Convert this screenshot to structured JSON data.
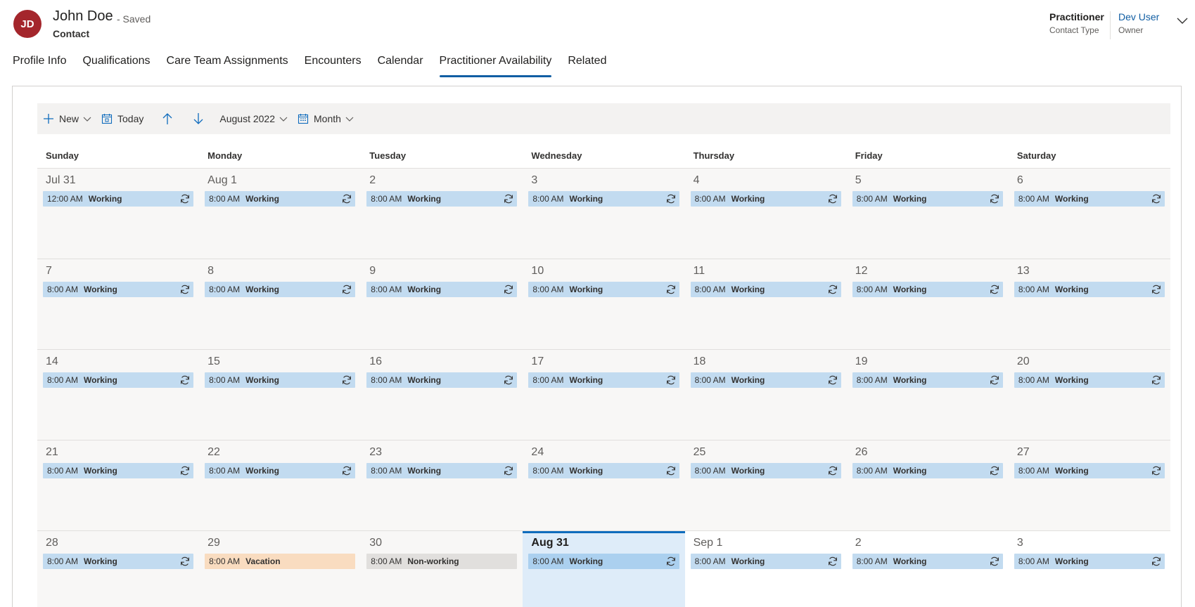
{
  "record": {
    "avatar_initials": "JD",
    "name": "John Doe",
    "saved_status": "- Saved",
    "entity": "Contact",
    "avatar_color": "#a4262c"
  },
  "header_fields": {
    "contact_type_value": "Practitioner",
    "contact_type_label": "Contact Type",
    "owner_value": "Dev User",
    "owner_label": "Owner"
  },
  "tabs": [
    {
      "label": "Profile Info"
    },
    {
      "label": "Qualifications"
    },
    {
      "label": "Care Team Assignments"
    },
    {
      "label": "Encounters"
    },
    {
      "label": "Calendar"
    },
    {
      "label": "Practitioner Availability",
      "active": true
    },
    {
      "label": "Related"
    }
  ],
  "toolbar": {
    "new_label": "New",
    "today_label": "Today",
    "date_label": "August 2022",
    "view_label": "Month"
  },
  "days_of_week": [
    "Sunday",
    "Monday",
    "Tuesday",
    "Wednesday",
    "Thursday",
    "Friday",
    "Saturday"
  ],
  "weeks": [
    [
      {
        "day": "Jul 31",
        "time": "12:00 AM",
        "title": "Working",
        "kind": "working"
      },
      {
        "day": "Aug 1",
        "time": "8:00 AM",
        "title": "Working",
        "kind": "working"
      },
      {
        "day": "2",
        "time": "8:00 AM",
        "title": "Working",
        "kind": "working"
      },
      {
        "day": "3",
        "time": "8:00 AM",
        "title": "Working",
        "kind": "working"
      },
      {
        "day": "4",
        "time": "8:00 AM",
        "title": "Working",
        "kind": "working"
      },
      {
        "day": "5",
        "time": "8:00 AM",
        "title": "Working",
        "kind": "working"
      },
      {
        "day": "6",
        "time": "8:00 AM",
        "title": "Working",
        "kind": "working"
      }
    ],
    [
      {
        "day": "7",
        "time": "8:00 AM",
        "title": "Working",
        "kind": "working"
      },
      {
        "day": "8",
        "time": "8:00 AM",
        "title": "Working",
        "kind": "working"
      },
      {
        "day": "9",
        "time": "8:00 AM",
        "title": "Working",
        "kind": "working"
      },
      {
        "day": "10",
        "time": "8:00 AM",
        "title": "Working",
        "kind": "working"
      },
      {
        "day": "11",
        "time": "8:00 AM",
        "title": "Working",
        "kind": "working"
      },
      {
        "day": "12",
        "time": "8:00 AM",
        "title": "Working",
        "kind": "working"
      },
      {
        "day": "13",
        "time": "8:00 AM",
        "title": "Working",
        "kind": "working"
      }
    ],
    [
      {
        "day": "14",
        "time": "8:00 AM",
        "title": "Working",
        "kind": "working"
      },
      {
        "day": "15",
        "time": "8:00 AM",
        "title": "Working",
        "kind": "working"
      },
      {
        "day": "16",
        "time": "8:00 AM",
        "title": "Working",
        "kind": "working"
      },
      {
        "day": "17",
        "time": "8:00 AM",
        "title": "Working",
        "kind": "working"
      },
      {
        "day": "18",
        "time": "8:00 AM",
        "title": "Working",
        "kind": "working"
      },
      {
        "day": "19",
        "time": "8:00 AM",
        "title": "Working",
        "kind": "working"
      },
      {
        "day": "20",
        "time": "8:00 AM",
        "title": "Working",
        "kind": "working"
      }
    ],
    [
      {
        "day": "21",
        "time": "8:00 AM",
        "title": "Working",
        "kind": "working"
      },
      {
        "day": "22",
        "time": "8:00 AM",
        "title": "Working",
        "kind": "working"
      },
      {
        "day": "23",
        "time": "8:00 AM",
        "title": "Working",
        "kind": "working"
      },
      {
        "day": "24",
        "time": "8:00 AM",
        "title": "Working",
        "kind": "working"
      },
      {
        "day": "25",
        "time": "8:00 AM",
        "title": "Working",
        "kind": "working"
      },
      {
        "day": "26",
        "time": "8:00 AM",
        "title": "Working",
        "kind": "working"
      },
      {
        "day": "27",
        "time": "8:00 AM",
        "title": "Working",
        "kind": "working"
      }
    ],
    [
      {
        "day": "28",
        "time": "8:00 AM",
        "title": "Working",
        "kind": "working"
      },
      {
        "day": "29",
        "time": "8:00 AM",
        "title": "Vacation",
        "kind": "vacation"
      },
      {
        "day": "30",
        "time": "8:00 AM",
        "title": "Non-working",
        "kind": "nonworking"
      },
      {
        "day": "Aug 31",
        "time": "8:00 AM",
        "title": "Working",
        "kind": "working",
        "today": true
      },
      {
        "day": "Sep 1",
        "time": "8:00 AM",
        "title": "Working",
        "kind": "working",
        "next_month": true
      },
      {
        "day": "2",
        "time": "8:00 AM",
        "title": "Working",
        "kind": "working",
        "next_month": true
      },
      {
        "day": "3",
        "time": "8:00 AM",
        "title": "Working",
        "kind": "working",
        "next_month": true
      }
    ]
  ],
  "colors": {
    "working": "#c2dbf0",
    "vacation": "#f9dcc0",
    "nonworking": "#e1dfdd",
    "accent": "#115ea3",
    "today_bg": "#deecf9"
  }
}
